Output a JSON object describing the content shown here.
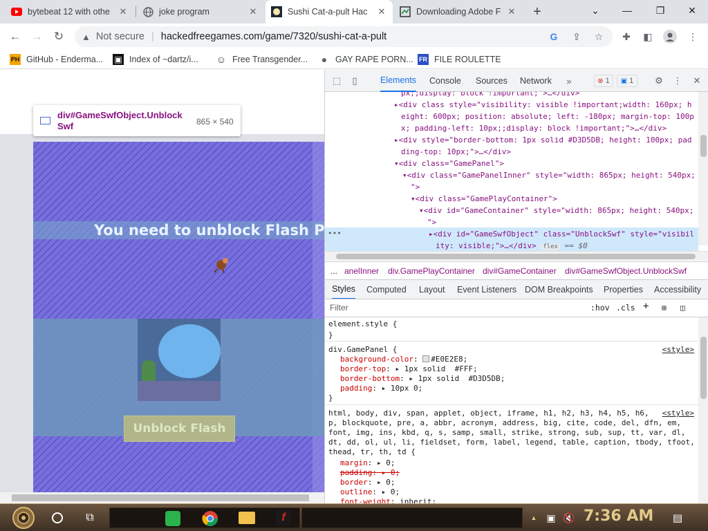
{
  "tabs": [
    {
      "title": "bytebeat 12 with othe",
      "icon": "youtube-icon",
      "color": "#ff0000"
    },
    {
      "title": "joke program",
      "icon": "globe-icon",
      "color": "#5f6368"
    },
    {
      "title": "Sushi Cat-a-pult Hac",
      "icon": "sushi-cat-favicon",
      "color": "#202124"
    },
    {
      "title": "Downloading Adobe F",
      "icon": "download-tab-icon",
      "color": "#1e8e3e"
    }
  ],
  "window_controls": {
    "new_tab": "+",
    "minimize": "⌄",
    "restore": "—",
    "maximize": "❐",
    "close": "✕"
  },
  "omnibox": {
    "security": "Not secure",
    "url": "hackedfreegames.com/game/7320/sushi-cat-a-pult"
  },
  "bookmarks": [
    {
      "label": "GitHub - Enderma...",
      "icon": "PH"
    },
    {
      "label": "Index of ~dartz/i...",
      "icon": "▣"
    },
    {
      "label": "Free Transgender...",
      "icon": "☺"
    },
    {
      "label": "GAY RAPE PORN...",
      "icon": "●"
    },
    {
      "label": "FILE ROULETTE",
      "icon": "FR"
    }
  ],
  "inspect_tooltip": {
    "name": "div#GameSwfObject.Unblock Swf",
    "size": "865 × 540"
  },
  "game": {
    "banner": "You need to unblock Flash Pl",
    "button": "Unblock Flash"
  },
  "devtools": {
    "tabs": [
      "Elements",
      "Console",
      "Sources",
      "Network"
    ],
    "error_count": "1",
    "message_count": "1",
    "dom_lines": [
      {
        "t": "px;;display: block !important;\">…</div>"
      },
      {
        "t": "<div class style=\"visibility: visible !important;width: 160px; h"
      },
      {
        "t": "eight: 600px; position: absolute; left: -180px; margin-top: 100p"
      },
      {
        "t": "x; padding-left: 10px;;display: block !important;\">…</div>"
      },
      {
        "t": "<div style=\"border-bottom: 1px solid #D3D5DB; height: 100px; pad"
      },
      {
        "t": "ding-top: 10px;\">…</div>"
      },
      {
        "t": "<div class=\"GamePanel\">"
      },
      {
        "t": "<div class=\"GamePanelInner\" style=\"width: 865px; height: 540px;"
      },
      {
        "t": "\">"
      },
      {
        "t": "<div class=\"GamePlayContainer\">"
      },
      {
        "t": "<div id=\"GameContainer\" style=\"width: 865px; height: 540px;"
      },
      {
        "t": "\">"
      },
      {
        "t": "<div id=\"GameSwfObject\" class=\"UnblockSwf\" style=\"visibil"
      },
      {
        "t": "ity: visible;\">…</div>"
      }
    ],
    "selected_suffix": "== $0",
    "flex_badge": "flex",
    "breadcrumbs": [
      "...",
      "anelInner",
      "div.GamePlayContainer",
      "div#GameContainer",
      "div#GameSwfObject.UnblockSwf"
    ],
    "style_tabs": [
      "Styles",
      "Computed",
      "Layout",
      "Event Listeners",
      "DOM Breakpoints",
      "Properties",
      "Accessibility"
    ],
    "filter_placeholder": "Filter",
    "hov": ":hov",
    "cls": ".cls",
    "element_style": "element.style {",
    "close_brace": "}",
    "gamepanel_selector": "div.GamePanel {",
    "gamepanel_props": [
      {
        "name": "background-color",
        "value": "#E0E2E8;",
        "swatch": "#E0E2E8"
      },
      {
        "name": "border-top",
        "value": "1px solid  #FFF;",
        "swatch": "#FFFFFF"
      },
      {
        "name": "border-bottom",
        "value": "1px solid  #D3D5DB;",
        "swatch": "#D3D5DB"
      },
      {
        "name": "padding",
        "value": "10px 0;"
      }
    ],
    "style_source": "<style>",
    "reset_selector_lines": [
      "html, body, div, span, applet, object, iframe, h1, h2, h3, h4, h5, h6,",
      "p, blockquote, pre, a, abbr, acronym, address, big, cite, code, del, dfn, em,",
      "font, img, ins, kbd, q, s, samp, small, strike, strong, sub, sup, tt, var, dl,",
      "dt, dd, ol, ul, li, fieldset, form, label, legend, table, caption, tbody, tfoot,",
      "thead, tr, th, td {"
    ],
    "reset_props": [
      {
        "name": "margin",
        "value": "0;"
      },
      {
        "name": "padding",
        "value": "0;",
        "struck": true
      },
      {
        "name": "border",
        "value": "0;"
      },
      {
        "name": "outline",
        "value": "0;"
      },
      {
        "name": "font-weight",
        "value": "inherit;"
      }
    ]
  },
  "taskbar": {
    "clock": "7:36 AM"
  }
}
